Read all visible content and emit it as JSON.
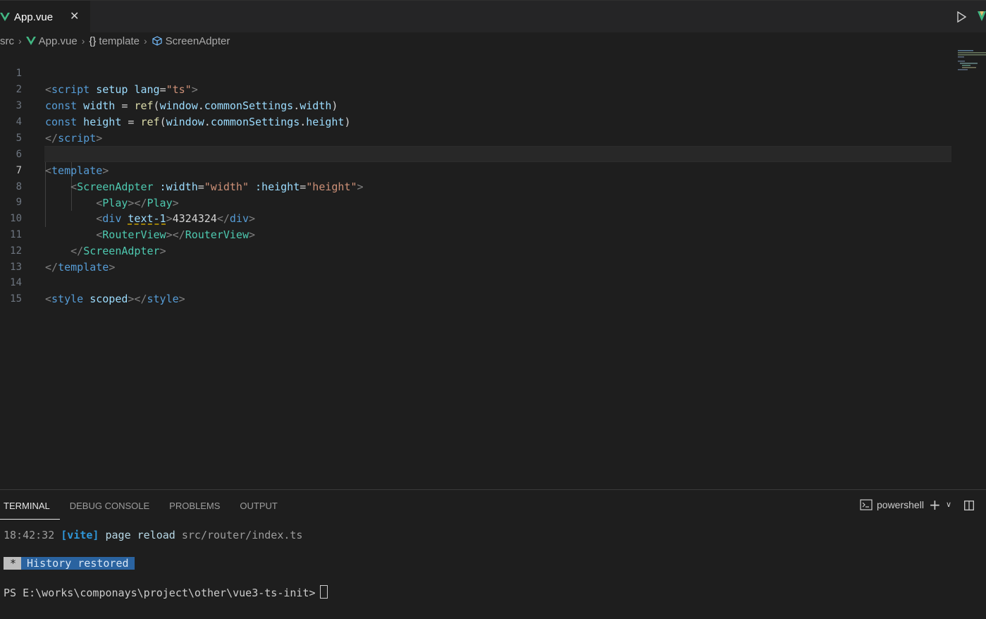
{
  "tab": {
    "label": "App.vue",
    "close": "✕"
  },
  "breadcrumb": {
    "items": [
      "src",
      "App.vue",
      "template",
      "ScreenAdpter"
    ],
    "template_brace": "{}"
  },
  "editor": {
    "line_numbers": [
      "1",
      "2",
      "3",
      "4",
      "5",
      "6",
      "7",
      "8",
      "9",
      "10",
      "11",
      "12",
      "13",
      "14",
      "15"
    ],
    "active_line": "7",
    "tokens": {
      "l1": [
        "<",
        "script",
        " setup",
        " lang",
        "=",
        "\"ts\"",
        ">"
      ],
      "l2": [
        "const",
        " width",
        " = ",
        "ref",
        "(",
        "window",
        ".",
        "commonSettings",
        ".",
        "width",
        ")"
      ],
      "l3": [
        "const",
        " height",
        " = ",
        "ref",
        "(",
        "window",
        ".",
        "commonSettings",
        ".",
        "height",
        ")"
      ],
      "l4": [
        "</",
        "script",
        ">"
      ],
      "l6": [
        "<",
        "template",
        ">"
      ],
      "l7": [
        "<",
        "ScreenAdpter",
        " :width",
        "=",
        "\"width\"",
        " :height",
        "=",
        "\"height\"",
        ">"
      ],
      "l8": [
        "<",
        "Play",
        "></",
        "Play",
        ">"
      ],
      "l9": [
        "<",
        "div",
        " ",
        "text-1",
        ">",
        "4324324",
        "</",
        "div",
        ">"
      ],
      "l10": [
        "<",
        "RouterView",
        "></",
        "RouterView",
        ">"
      ],
      "l11": [
        "</",
        "ScreenAdpter",
        ">"
      ],
      "l12": [
        "</",
        "template",
        ">"
      ],
      "l14": [
        "<",
        "style",
        " scoped",
        "></",
        "style",
        ">"
      ]
    }
  },
  "panel": {
    "tabs": [
      "TERMINAL",
      "DEBUG CONSOLE",
      "PROBLEMS",
      "OUTPUT"
    ],
    "active_tab": "TERMINAL",
    "shell_label": "powershell",
    "terminal": {
      "line1_time": "18:42:32",
      "line1_tag": "[vite]",
      "line1_msg": "page reload",
      "line1_path": "src/router/index.ts",
      "history_star": "*",
      "history_label": "History restored",
      "prompt": "PS E:\\works\\componays\\project\\other\\vue3-ts-init>"
    }
  },
  "colors": {
    "editor_bg": "#1e1e1e",
    "tab_bar_bg": "#252526",
    "vue_green": "#42b883",
    "vite_blue": "#2f96d8"
  }
}
